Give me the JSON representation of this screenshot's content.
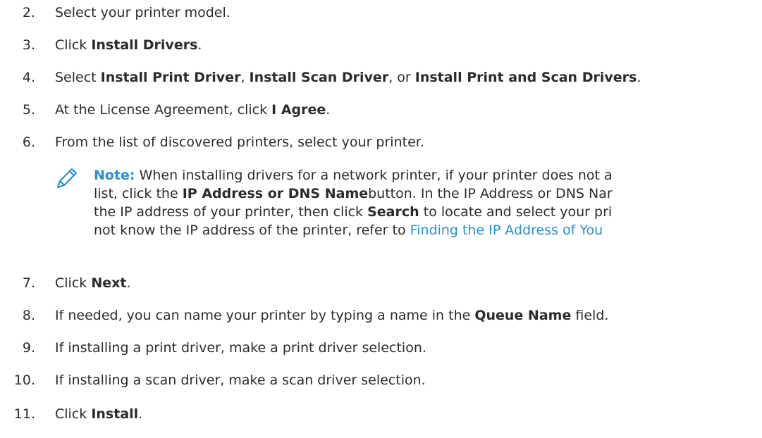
{
  "steps": [
    {
      "num": "2.",
      "text": "Select your printer model."
    },
    {
      "num": "3.",
      "pre": "Click ",
      "bold": "Install Drivers",
      "post": "."
    },
    {
      "num": "4.",
      "pre": "Select ",
      "b1": "Install Print Driver",
      "m1": ", ",
      "b2": "Install Scan Driver",
      "m2": ", or ",
      "b3": "Install Print and Scan Drivers",
      "post": "."
    },
    {
      "num": "5.",
      "pre": "At the License Agreement, click ",
      "bold": "I Agree",
      "post": "."
    },
    {
      "num": "6.",
      "text": "From the list of discovered printers, select your printer."
    },
    {
      "num": "7.",
      "pre": "Click ",
      "bold": "Next",
      "post": "."
    },
    {
      "num": "8.",
      "pre": "If needed, you can name your printer by typing a name in the ",
      "bold": "Queue Name",
      "post": " field."
    },
    {
      "num": "9.",
      "text": "If installing a print driver, make a print driver selection."
    },
    {
      "num": "10.",
      "text": "If installing a scan driver, make a scan driver selection."
    },
    {
      "num": "11.",
      "pre": "Click ",
      "bold": "Install",
      "post": "."
    }
  ],
  "note": {
    "icon": "pencil-icon",
    "label": "Note:",
    "line1": " When installing drivers for a network printer, if your printer does not a",
    "line2_pre": "list, click the ",
    "line2_bold": "IP Address or DNS Name",
    "line2_post": "button. In the IP Address or DNS Nar",
    "line3_pre": "the IP address of your printer, then click ",
    "line3_bold": "Search",
    "line3_post": " to locate and select your pri",
    "line4_pre": "not know the IP address of the printer, refer to ",
    "line4_link": "Finding the IP Address of You",
    "accent_color": "#2a8fd0"
  }
}
